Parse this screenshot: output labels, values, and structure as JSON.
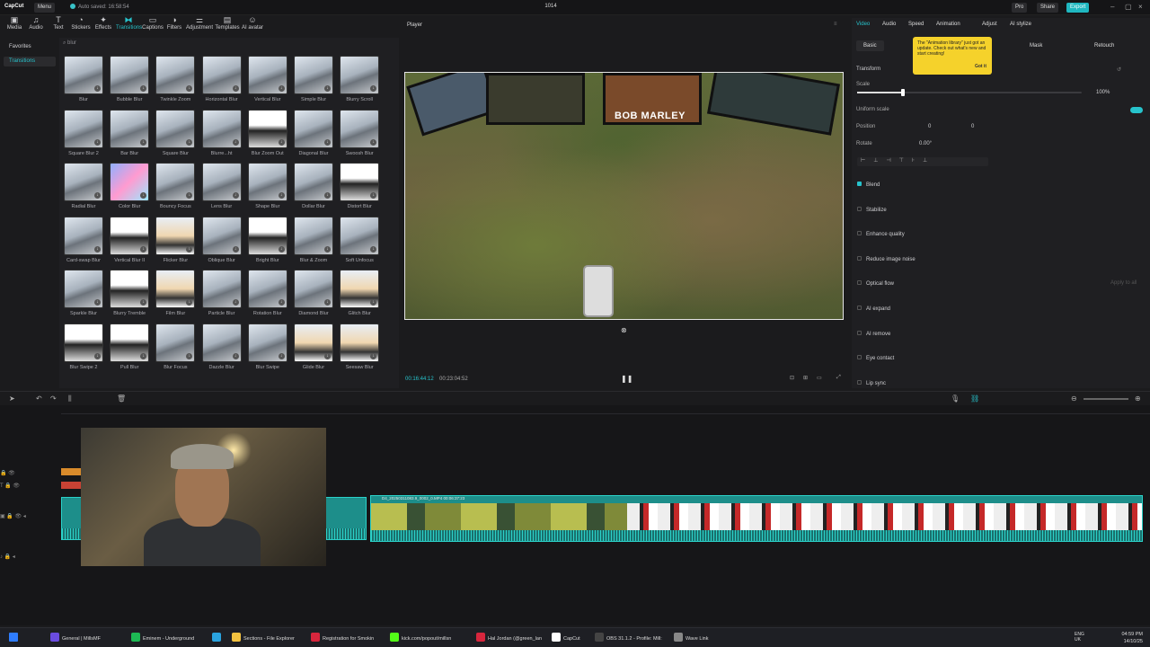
{
  "app": {
    "name": "CapCut",
    "menu": "Menu",
    "autosave": "Auto saved: 16:58:54",
    "project": "1014"
  },
  "header_buttons": {
    "pro": "Pro",
    "share": "Share",
    "export": "Export"
  },
  "toolbar": [
    {
      "label": "Media",
      "icon": "media-icon"
    },
    {
      "label": "Audio",
      "icon": "audio-icon"
    },
    {
      "label": "Text",
      "icon": "text-icon"
    },
    {
      "label": "Stickers",
      "icon": "stickers-icon"
    },
    {
      "label": "Effects",
      "icon": "effects-icon"
    },
    {
      "label": "Transitions",
      "icon": "transitions-icon"
    },
    {
      "label": "Captions",
      "icon": "captions-icon"
    },
    {
      "label": "Filters",
      "icon": "filters-icon"
    },
    {
      "label": "Adjustment",
      "icon": "adjustment-icon"
    },
    {
      "label": "Templates",
      "icon": "templates-icon"
    },
    {
      "label": "AI avatar",
      "icon": "ai-avatar-icon"
    }
  ],
  "leftnav": {
    "favorites": "Favorites",
    "transitions": "Transitions"
  },
  "search": {
    "value": "blur"
  },
  "transitions": [
    "Blur",
    "Bubble Blur",
    "Twinkle Zoom",
    "Horizontal Blur",
    "Vertical Blur",
    "Simple Blur",
    "Blurry Scroll",
    "Square Blur 2",
    "Bar Blur",
    "Square Blur",
    "Blurre...ht",
    "Blur Zoom Out",
    "Diagonal Blur",
    "Swoosh Blur",
    "Radial Blur",
    "Color Blur",
    "Bouncy Focus",
    "Lens Blur",
    "Shape Blur",
    "Dollar Blur",
    "Distort Blur",
    "Card-swap Blur",
    "Vertical Blur II",
    "Flicker Blur",
    "Oblique Blur",
    "Bright Blur",
    "Blur & Zoom",
    "Soft Unfocus",
    "Sparkle Blur",
    "Blurry Tremble",
    "Film Blur",
    "Particle Blur",
    "Rotation Blur",
    "Diamond Blur",
    "Glitch Blur",
    "Blur Swipe 2",
    "Pull Blur",
    "Blur Focus",
    "Dazzle Blur",
    "Blur Swipe",
    "Glide Blur",
    "Seesaw Blur"
  ],
  "player": {
    "title": "Player",
    "current_time": "00:16:44:12",
    "total_time": "00:23:04:52",
    "overlay_text": "BOB MARLEY"
  },
  "props": {
    "tabs": [
      "Video",
      "Audio",
      "Speed",
      "Animation",
      "Adjust",
      "AI stylize"
    ],
    "subtabs": [
      "Basic",
      "Mask",
      "Retouch"
    ],
    "tooltip": {
      "text": "The \"Animation library\" just got an update. Check out what's new and start creating!",
      "button": "Got it"
    },
    "transform": "Transform",
    "scale_label": "Scale",
    "scale_value": "100%",
    "uniform_scale": "Uniform scale",
    "position_label": "Position",
    "pos_x": "0",
    "pos_y": "0",
    "rotate_label": "Rotate",
    "rotate_value": "0.00°",
    "sections": [
      "Blend",
      "Stabilize",
      "Enhance quality",
      "Reduce image noise",
      "Optical flow",
      "AI expand",
      "AI remove",
      "Eye contact",
      "Lip sync"
    ],
    "apply_all": "Apply to all"
  },
  "timeline": {
    "clip_label": "D4_20250311083.9_0002_0.MP4  00:06:37:23"
  },
  "taskbar": [
    {
      "label": "General | MillsMF",
      "color": "#6a4ce0"
    },
    {
      "label": "Eminem - Underground",
      "color": "#1db954"
    },
    {
      "label": "",
      "color": "#2aa3df"
    },
    {
      "label": "Sections - File Explorer",
      "color": "#f3c240"
    },
    {
      "label": "Registration for Smokin",
      "color": "#d7263d"
    },
    {
      "label": "kick.com/popout/millsn",
      "color": "#53fc18"
    },
    {
      "label": "Hal Jordan (@green_lan",
      "color": "#d7263d"
    },
    {
      "label": "CapCut",
      "color": "#ffffff"
    },
    {
      "label": "OBS 31.1.2 - Profile: Mill:",
      "color": "#444"
    },
    {
      "label": "Wave Link",
      "color": "#888"
    }
  ],
  "tray": {
    "lang": "ENG",
    "region": "UK",
    "time": "04:59 PM",
    "date": "14/10/25"
  }
}
